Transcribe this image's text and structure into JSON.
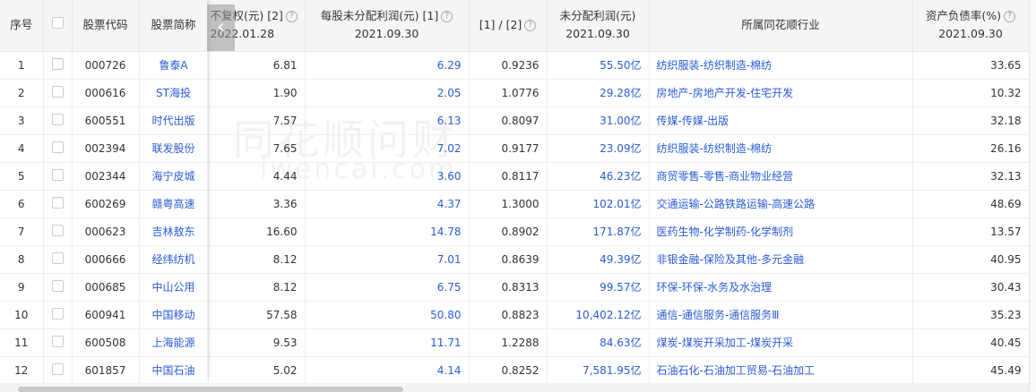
{
  "headers": {
    "seq": "序号",
    "code": "股票代码",
    "name": "股票简称",
    "price": "不复权(元) [2]",
    "price_date": "2022.01.28",
    "eps": "每股未分配利润(元) [1]",
    "eps_date": "2021.09.30",
    "ratio": "[1] / [2]",
    "undist": "未分配利润(元)",
    "undist_date": "2021.09.30",
    "industry": "所属同花顺行业",
    "debt": "资产负债率(%)",
    "debt_date": "2021.09.30",
    "help": "?"
  },
  "watermark": {
    "cn": "同花顺问财",
    "en": "iwencai.com"
  },
  "rows": [
    {
      "seq": "1",
      "code": "000726",
      "name": "鲁泰A",
      "price": "6.81",
      "eps": "6.29",
      "ratio": "0.9236",
      "undist": "55.50亿",
      "industry": "纺织服装-纺织制造-棉纺",
      "debt": "33.65"
    },
    {
      "seq": "2",
      "code": "000616",
      "name": "ST海投",
      "price": "1.90",
      "eps": "2.05",
      "ratio": "1.0776",
      "undist": "29.28亿",
      "industry": "房地产-房地产开发-住宅开发",
      "debt": "10.32"
    },
    {
      "seq": "3",
      "code": "600551",
      "name": "时代出版",
      "price": "7.57",
      "eps": "6.13",
      "ratio": "0.8097",
      "undist": "31.00亿",
      "industry": "传媒-传媒-出版",
      "debt": "32.18"
    },
    {
      "seq": "4",
      "code": "002394",
      "name": "联发股份",
      "price": "7.65",
      "eps": "7.02",
      "ratio": "0.9177",
      "undist": "23.09亿",
      "industry": "纺织服装-纺织制造-棉纺",
      "debt": "26.16"
    },
    {
      "seq": "5",
      "code": "002344",
      "name": "海宁皮城",
      "price": "4.44",
      "eps": "3.60",
      "ratio": "0.8117",
      "undist": "46.23亿",
      "industry": "商贸零售-零售-商业物业经营",
      "debt": "32.13"
    },
    {
      "seq": "6",
      "code": "600269",
      "name": "赣粤高速",
      "price": "3.36",
      "eps": "4.37",
      "ratio": "1.3000",
      "undist": "102.01亿",
      "industry": "交通运输-公路铁路运输-高速公路",
      "debt": "48.69"
    },
    {
      "seq": "7",
      "code": "000623",
      "name": "吉林敖东",
      "price": "16.60",
      "eps": "14.78",
      "ratio": "0.8902",
      "undist": "171.87亿",
      "industry": "医药生物-化学制药-化学制剂",
      "debt": "13.57"
    },
    {
      "seq": "8",
      "code": "000666",
      "name": "经纬纺机",
      "price": "8.12",
      "eps": "7.01",
      "ratio": "0.8639",
      "undist": "49.39亿",
      "industry": "非银金融-保险及其他-多元金融",
      "debt": "40.95"
    },
    {
      "seq": "9",
      "code": "000685",
      "name": "中山公用",
      "price": "8.12",
      "eps": "6.75",
      "ratio": "0.8313",
      "undist": "99.57亿",
      "industry": "环保-环保-水务及水治理",
      "debt": "30.43"
    },
    {
      "seq": "10",
      "code": "600941",
      "name": "中国移动",
      "price": "57.58",
      "eps": "50.80",
      "ratio": "0.8823",
      "undist": "10,402.12亿",
      "industry": "通信-通信服务-通信服务Ⅲ",
      "debt": "35.23"
    },
    {
      "seq": "11",
      "code": "600508",
      "name": "上海能源",
      "price": "9.53",
      "eps": "11.71",
      "ratio": "1.2288",
      "undist": "84.63亿",
      "industry": "煤炭-煤炭开采加工-煤炭开采",
      "debt": "40.45"
    },
    {
      "seq": "12",
      "code": "601857",
      "name": "中国石油",
      "price": "5.02",
      "eps": "4.14",
      "ratio": "0.8252",
      "undist": "7,581.95亿",
      "industry": "石油石化-石油加工贸易-石油加工",
      "debt": "45.49"
    }
  ]
}
